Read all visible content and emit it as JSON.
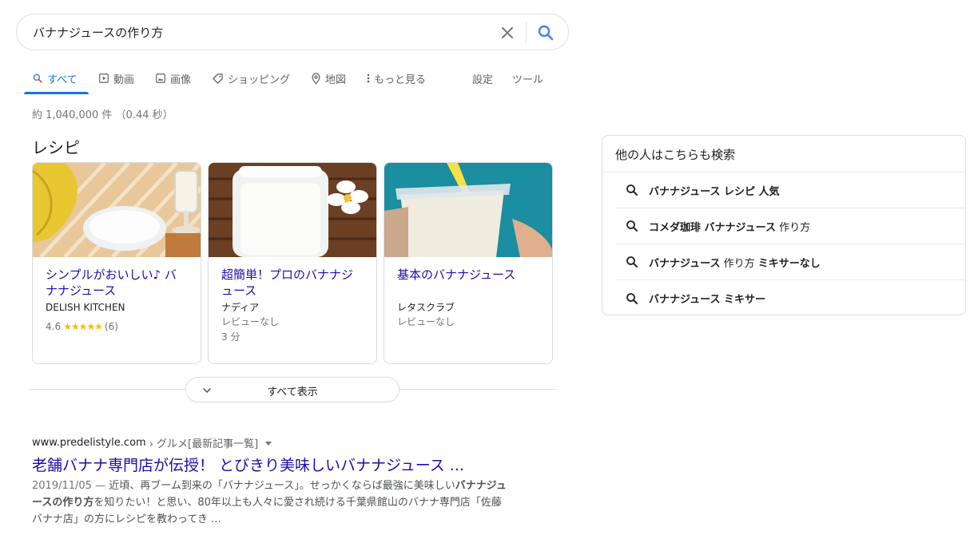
{
  "search": {
    "query": "バナナジュースの作り方"
  },
  "tabs": [
    {
      "label": "すべて",
      "icon": "search-icon",
      "active": true
    },
    {
      "label": "動画",
      "icon": "video-icon"
    },
    {
      "label": "画像",
      "icon": "image-icon"
    },
    {
      "label": "ショッピング",
      "icon": "tag-icon"
    },
    {
      "label": "地図",
      "icon": "map-pin-icon"
    },
    {
      "label": "もっと見る",
      "icon": "more-vert-icon"
    }
  ],
  "tools": {
    "settings": "設定",
    "tools": "ツール"
  },
  "result_stats": "約 1,040,000 件 （0.44 秒）",
  "recipes": {
    "title": "レシピ",
    "cards": [
      {
        "title": "シンプルがおいしい♪ バナナジュース",
        "source": "DELISH KITCHEN",
        "rating": "4.6",
        "stars": "★★★★★",
        "reviews": "(6)"
      },
      {
        "title": "超簡単！プロのバナナジュース",
        "source": "ナディア",
        "meta1": "レビューなし",
        "meta2": "3 分"
      },
      {
        "title": "基本のバナナジュース",
        "source": "レタスクラブ",
        "meta1": "レビューなし"
      }
    ],
    "show_all": "すべて表示"
  },
  "result": {
    "domain": "www.predelistyle.com",
    "breadcrumb": "› グルメ[最新記事一覧]",
    "title": "老舗バナナ専門店が伝授！ とびきり美味しいバナナジュース ...",
    "date": "2019/11/05 — ",
    "snippet_1": "近頃、再ブーム到来の「バナナジュース」。せっかくならば最強に美味しい",
    "snippet_bold_1": "バナナジュースの作り方",
    "snippet_2": "を知りたい！と思い、80年以上も人々に愛され続ける千葉県館山のバナナ専門店「佐藤バナナ店」の方にレシピを教わってき ..."
  },
  "related": {
    "title": "他の人はこちらも検索",
    "items": [
      {
        "b1": "バナナジュース レシピ 人気",
        "n1": "",
        "b2": ""
      },
      {
        "b1": "コメダ珈琲 バナナジュース",
        "n1": " 作り方",
        "b2": ""
      },
      {
        "b1": "バナナジュース",
        "n1": " 作り方 ",
        "b2": "ミキサーなし"
      },
      {
        "b1": "バナナジュース ミキサー",
        "n1": "",
        "b2": ""
      }
    ]
  },
  "colors": {
    "link": "#1a0dab",
    "accent": "#1a73e8",
    "star": "#fbbc04"
  }
}
